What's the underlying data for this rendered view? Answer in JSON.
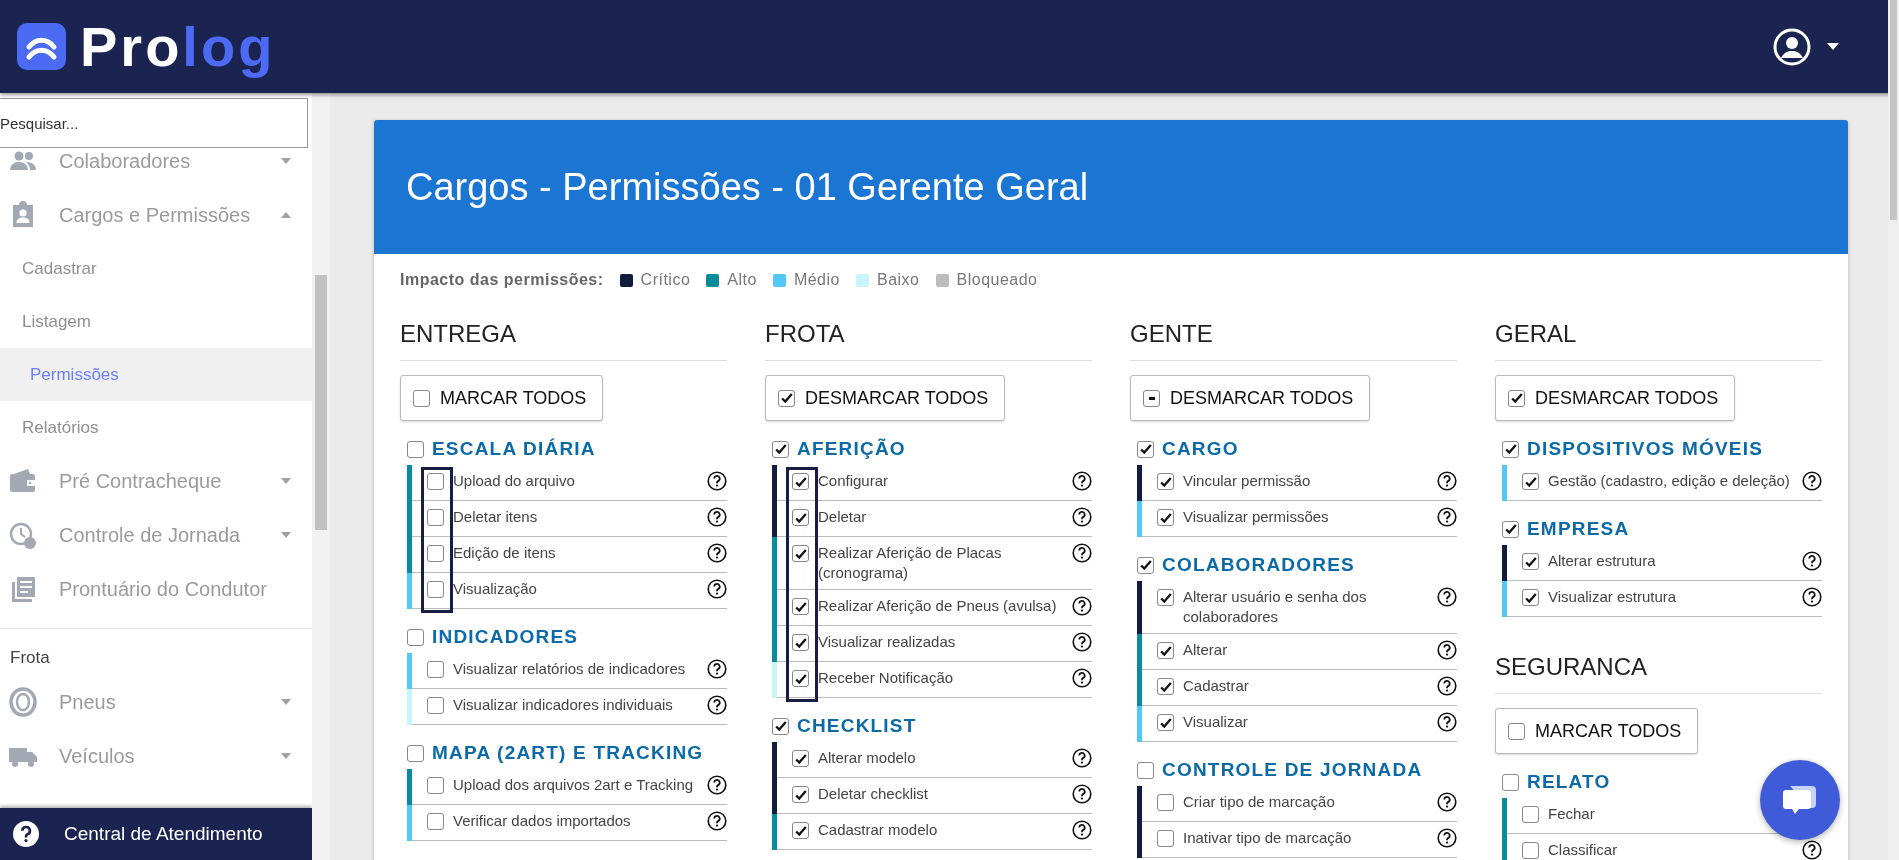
{
  "header": {
    "brand_parts": [
      "Pro",
      "log"
    ]
  },
  "sidebar": {
    "search": {
      "placeholder": "Pesquisar..."
    },
    "items": [
      {
        "kind": "menu",
        "label": "Colaboradores",
        "expanded": false
      },
      {
        "kind": "menu",
        "label": "Cargos e Permissões",
        "expanded": true,
        "children": [
          {
            "label": "Cadastrar",
            "selected": false
          },
          {
            "label": "Listagem",
            "selected": false
          },
          {
            "label": "Permissões",
            "selected": true
          },
          {
            "label": "Relatórios",
            "selected": false
          }
        ]
      },
      {
        "kind": "menu",
        "label": "Pré Contracheque",
        "expanded": false
      },
      {
        "kind": "menu",
        "label": "Controle de Jornada",
        "expanded": false
      },
      {
        "kind": "link",
        "label": "Prontuário do Condutor"
      },
      {
        "kind": "section",
        "label": "Frota"
      },
      {
        "kind": "menu",
        "label": "Pneus",
        "expanded": false
      },
      {
        "kind": "menu",
        "label": "Veículos",
        "expanded": false
      }
    ],
    "footer": {
      "label": "Central de Atendimento"
    }
  },
  "card": {
    "title": "Cargos - Permissões - 01 Gerente Geral",
    "legend": {
      "label": "Impacto das permissões:",
      "items": [
        {
          "label": "Crítico",
          "color": "#121c3e"
        },
        {
          "label": "Alto",
          "color": "#0b8c9c"
        },
        {
          "label": "Médio",
          "color": "#54c8f5"
        },
        {
          "label": "Baixo",
          "color": "#c6f5fb"
        },
        {
          "label": "Bloqueado",
          "color": "#bdbdbd"
        }
      ]
    },
    "columns": [
      {
        "modules": [
          {
            "title": "ENTREGA",
            "toggle": {
              "label": "MARCAR TODOS",
              "checked": false,
              "indeterminate": false
            },
            "groups": [
              {
                "title": "ESCALA DIÁRIA",
                "checked": false,
                "highlighted": true,
                "permissions": [
                  {
                    "label": "Upload do arquivo",
                    "checked": false,
                    "color": "#0b8c9c"
                  },
                  {
                    "label": "Deletar itens",
                    "checked": false,
                    "color": "#0b8c9c"
                  },
                  {
                    "label": "Edição de itens",
                    "checked": false,
                    "color": "#0b8c9c"
                  },
                  {
                    "label": "Visualização",
                    "checked": false,
                    "color": "#54c8f5"
                  }
                ]
              },
              {
                "title": "INDICADORES",
                "checked": false,
                "highlighted": false,
                "permissions": [
                  {
                    "label": "Visualizar relatórios de indicadores",
                    "checked": false,
                    "color": "#54c8f5"
                  },
                  {
                    "label": "Visualizar indicadores individuais",
                    "checked": false,
                    "color": "#c6f5fb"
                  }
                ]
              },
              {
                "title": "MAPA (2ART) E TRACKING",
                "checked": false,
                "highlighted": false,
                "permissions": [
                  {
                    "label": "Upload dos arquivos 2art e Tracking",
                    "checked": false,
                    "color": "#0b8c9c"
                  },
                  {
                    "label": "Verificar dados importados",
                    "checked": false,
                    "color": "#54c8f5"
                  }
                ]
              }
            ]
          }
        ]
      },
      {
        "modules": [
          {
            "title": "FROTA",
            "toggle": {
              "label": "DESMARCAR TODOS",
              "checked": true,
              "indeterminate": false
            },
            "groups": [
              {
                "title": "AFERIÇÃO",
                "checked": true,
                "highlighted": true,
                "permissions": [
                  {
                    "label": "Configurar",
                    "checked": true,
                    "color": "#121c3e"
                  },
                  {
                    "label": "Deletar",
                    "checked": true,
                    "color": "#121c3e"
                  },
                  {
                    "label": "Realizar Aferição de Placas (cronograma)",
                    "checked": true,
                    "color": "#0b8c9c"
                  },
                  {
                    "label": "Realizar Aferição de Pneus (avulsa)",
                    "checked": true,
                    "color": "#0b8c9c"
                  },
                  {
                    "label": "Visualizar realizadas",
                    "checked": true,
                    "color": "#0b8c9c"
                  },
                  {
                    "label": "Receber Notificação",
                    "checked": true,
                    "color": "#c6f5fb"
                  }
                ]
              },
              {
                "title": "CHECKLIST",
                "checked": true,
                "highlighted": false,
                "permissions": [
                  {
                    "label": "Alterar modelo",
                    "checked": true,
                    "color": "#121c3e"
                  },
                  {
                    "label": "Deletar checklist",
                    "checked": true,
                    "color": "#121c3e"
                  },
                  {
                    "label": "Cadastrar modelo",
                    "checked": true,
                    "color": "#0b8c9c"
                  }
                ]
              }
            ]
          }
        ]
      },
      {
        "modules": [
          {
            "title": "GENTE",
            "toggle": {
              "label": "DESMARCAR TODOS",
              "checked": false,
              "indeterminate": true
            },
            "groups": [
              {
                "title": "CARGO",
                "checked": true,
                "highlighted": false,
                "permissions": [
                  {
                    "label": "Vincular permissão",
                    "checked": true,
                    "color": "#121c3e"
                  },
                  {
                    "label": "Visualizar permissões",
                    "checked": true,
                    "color": "#54c8f5"
                  }
                ]
              },
              {
                "title": "COLABORADORES",
                "checked": true,
                "highlighted": false,
                "permissions": [
                  {
                    "label": "Alterar usuário e senha dos colaboradores",
                    "checked": true,
                    "color": "#121c3e"
                  },
                  {
                    "label": "Alterar",
                    "checked": true,
                    "color": "#0b8c9c"
                  },
                  {
                    "label": "Cadastrar",
                    "checked": true,
                    "color": "#0b8c9c"
                  },
                  {
                    "label": "Visualizar",
                    "checked": true,
                    "color": "#54c8f5"
                  }
                ]
              },
              {
                "title": "CONTROLE DE JORNADA",
                "checked": false,
                "highlighted": false,
                "permissions": [
                  {
                    "label": "Criar tipo de marcação",
                    "checked": false,
                    "color": "#121c3e"
                  },
                  {
                    "label": "Inativar tipo de marcação",
                    "checked": false,
                    "color": "#121c3e"
                  }
                ]
              }
            ]
          }
        ]
      },
      {
        "modules": [
          {
            "title": "GERAL",
            "toggle": {
              "label": "DESMARCAR TODOS",
              "checked": true,
              "indeterminate": false
            },
            "groups": [
              {
                "title": "DISPOSITIVOS MÓVEIS",
                "checked": true,
                "highlighted": false,
                "permissions": [
                  {
                    "label": "Gestão (cadastro, edição e deleção)",
                    "checked": true,
                    "color": "#54c8f5"
                  }
                ]
              },
              {
                "title": "EMPRESA",
                "checked": true,
                "highlighted": false,
                "permissions": [
                  {
                    "label": "Alterar estrutura",
                    "checked": true,
                    "color": "#121c3e"
                  },
                  {
                    "label": "Visualizar estrutura",
                    "checked": true,
                    "color": "#54c8f5"
                  }
                ]
              }
            ]
          },
          {
            "title": "SEGURANCA",
            "toggle": {
              "label": "MARCAR TODOS",
              "checked": false,
              "indeterminate": false
            },
            "groups": [
              {
                "title": "RELATO",
                "checked": false,
                "highlighted": false,
                "permissions": [
                  {
                    "label": "Fechar",
                    "checked": false,
                    "color": "#0b8c9c"
                  },
                  {
                    "label": "Classificar",
                    "checked": false,
                    "color": "#0b8c9c"
                  }
                ]
              }
            ]
          }
        ]
      }
    ]
  }
}
